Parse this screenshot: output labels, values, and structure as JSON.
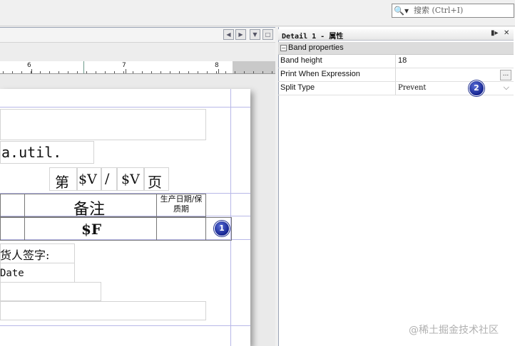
{
  "search": {
    "icon": "search-icon",
    "placeholder": "搜索 (Ctrl+I)"
  },
  "ruler": {
    "labels": [
      "6",
      "7",
      "8"
    ]
  },
  "report": {
    "util_text": "a.util.",
    "page_label_prefix": "第",
    "page_var1": "$V",
    "page_slash": "/",
    "page_var2": "$V",
    "page_label_suffix": "页",
    "header_remark": "备注",
    "header_production_date": "生产日期/保质期",
    "field_f": "$F",
    "shipper_signature": "货人签字:",
    "date_label": "Date",
    "marker1": "1"
  },
  "properties": {
    "title": "Detail 1 - 属性",
    "category": "Band properties",
    "rows": [
      {
        "key": "Band height",
        "value": "18"
      },
      {
        "key": "Print When Expression",
        "value": ""
      },
      {
        "key": "Split Type",
        "value": "Prevent"
      }
    ],
    "marker2": "2"
  },
  "watermark": "@稀土掘金技术社区",
  "colors": {
    "guide": "#b8b8e8",
    "badge": "#14238f"
  }
}
